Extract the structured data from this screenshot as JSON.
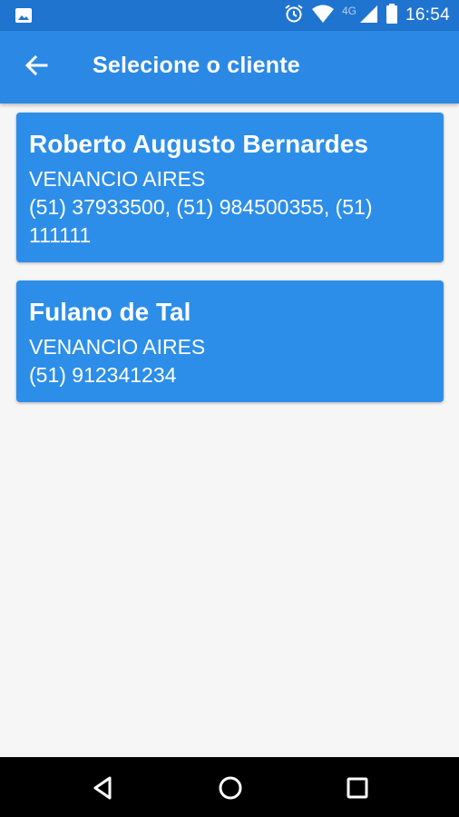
{
  "status_bar": {
    "network": "4G",
    "time": "16:54",
    "icons": [
      "image-icon",
      "alarm-icon",
      "wifi-icon",
      "signal-icon",
      "battery-icon"
    ]
  },
  "app_bar": {
    "title": "Selecione o cliente",
    "back_icon": "arrow-left-icon"
  },
  "clients": [
    {
      "name": "Roberto Augusto Bernardes",
      "city": "VENANCIO AIRES",
      "phones": "(51) 37933500, (51) 984500355, (51) 111111"
    },
    {
      "name": "Fulano de Tal",
      "city": "VENANCIO AIRES",
      "phones": "(51) 912341234"
    }
  ],
  "nav_bar": {
    "buttons": [
      "back-triangle-icon",
      "home-circle-icon",
      "recents-square-icon"
    ]
  },
  "colors": {
    "status_bar": "#1f74cf",
    "app_bar": "#2b89e5",
    "card": "#2c8ee8",
    "background": "#f6f6f6"
  }
}
